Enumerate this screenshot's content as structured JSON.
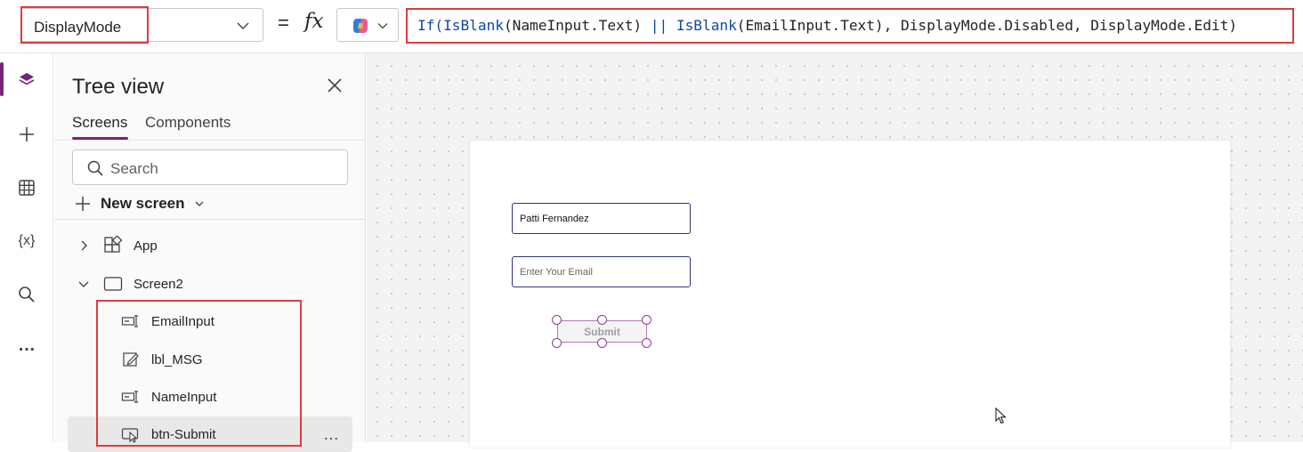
{
  "formula_bar": {
    "property": "DisplayMode",
    "equals": "=",
    "fx": "fx",
    "formula": {
      "t1": "If(",
      "t2": "IsBlank",
      "t3": "(NameInput.Text) ",
      "t4": "||",
      "t5": " ",
      "t6": "IsBlank",
      "t7": "(EmailInput.Text), DisplayMode.Disabled, DisplayMode.Edit)"
    }
  },
  "rail": {
    "variables_label": "{x}",
    "more_label": "…"
  },
  "tree": {
    "title": "Tree view",
    "tabs": {
      "screens": "Screens",
      "components": "Components"
    },
    "search_placeholder": "Search",
    "new_screen_label": "New screen",
    "items": {
      "app": "App",
      "screen": "Screen2",
      "email_input": "EmailInput",
      "lbl_msg": "lbl_MSG",
      "name_input": "NameInput",
      "btn_submit": "btn-Submit"
    },
    "more_label": "…"
  },
  "canvas": {
    "name_value": "Patti Fernandez",
    "email_placeholder": "Enter Your Email",
    "submit_label": "Submit"
  },
  "colors": {
    "accent": "#742774",
    "highlight": "#e03b3b",
    "formula_keyword": "#0f4aa7",
    "input_border": "#2d3580"
  }
}
